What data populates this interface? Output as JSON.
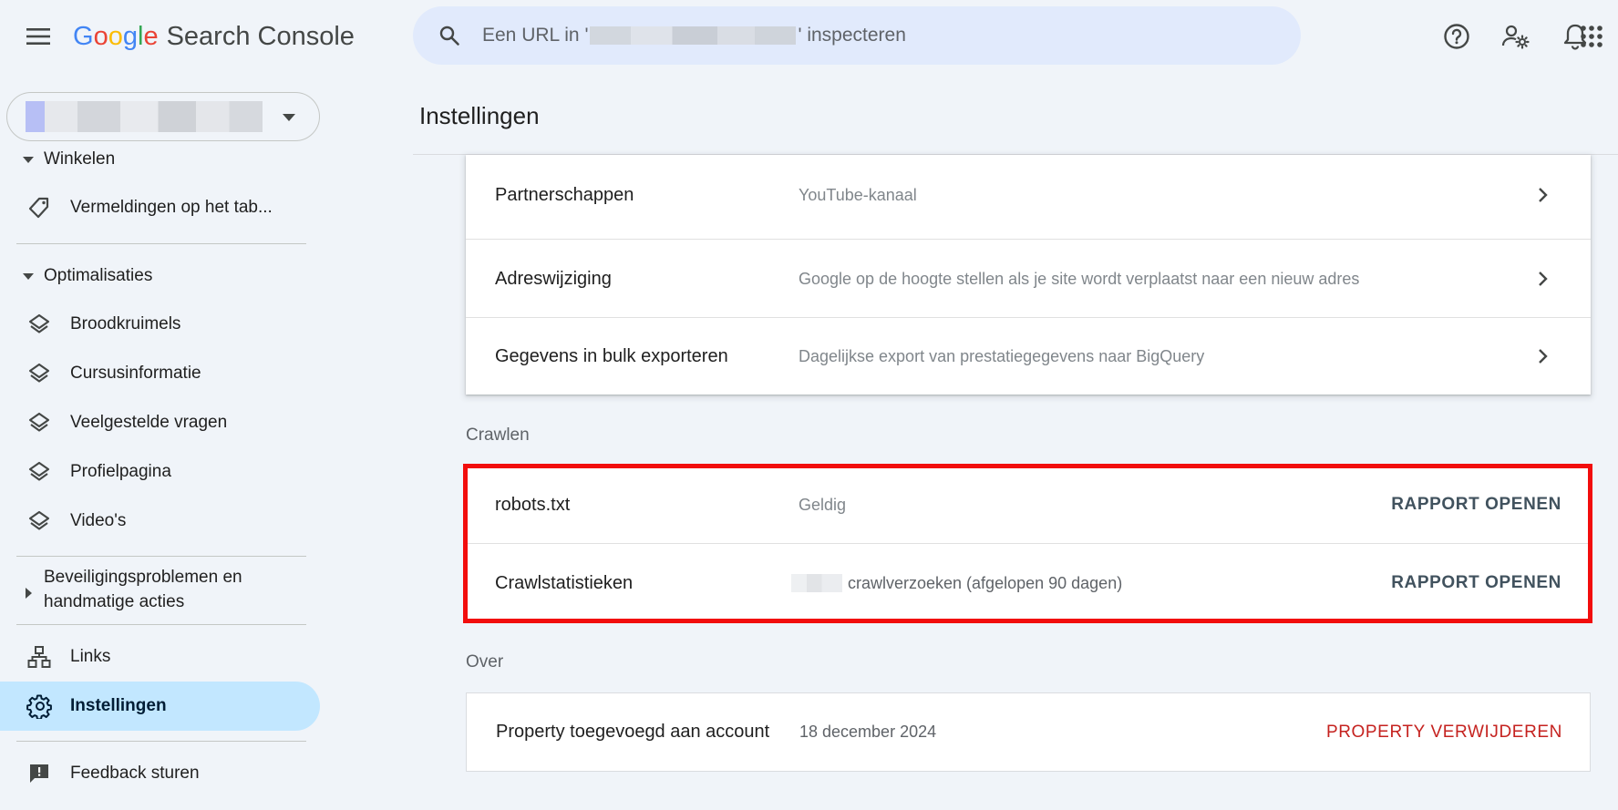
{
  "header": {
    "logo_google": "Google",
    "product_name": "Search Console",
    "search_prefix": "Een URL in '",
    "search_suffix": "' inspecteren",
    "icons": [
      "menu-icon",
      "search-icon",
      "help-icon",
      "manage-users-icon",
      "notifications-icon",
      "apps-grid-icon"
    ]
  },
  "sidebar": {
    "shopping_section": "Winkelen",
    "shopping_items": [
      {
        "label": "Vermeldingen op het tab...",
        "icon": "tag-icon"
      }
    ],
    "enhancements_section": "Optimalisaties",
    "enhancement_items": [
      {
        "label": "Broodkruimels",
        "icon": "layers-icon"
      },
      {
        "label": "Cursusinformatie",
        "icon": "layers-icon"
      },
      {
        "label": "Veelgestelde vragen",
        "icon": "layers-icon"
      },
      {
        "label": "Profielpagina",
        "icon": "layers-icon"
      },
      {
        "label": "Video's",
        "icon": "layers-icon"
      }
    ],
    "security_section_line1": "Beveiligingsproblemen en",
    "security_section_line2": "handmatige acties",
    "links_label": "Links",
    "settings_label": "Instellingen",
    "feedback_label": "Feedback sturen"
  },
  "main": {
    "page_title": "Instellingen",
    "general_rows": [
      {
        "name": "Partnerschappen",
        "desc": "YouTube-kanaal"
      },
      {
        "name": "Adreswijziging",
        "desc": "Google op de hoogte stellen als je site wordt verplaatst naar een nieuw adres"
      },
      {
        "name": "Gegevens in bulk exporteren",
        "desc": "Dagelijkse export van prestatiegegevens naar BigQuery"
      }
    ],
    "crawl_label": "Crawlen",
    "crawl_rows": [
      {
        "name": "robots.txt",
        "desc": "Geldig",
        "action": "RAPPORT OPENEN"
      },
      {
        "name": "Crawlstatistieken",
        "desc": "crawlverzoeken (afgelopen 90 dagen)",
        "action": "RAPPORT OPENEN"
      }
    ],
    "about_label": "Over",
    "about_row": {
      "name": "Property toegevoegd aan account",
      "desc": "18 december 2024",
      "action": "PROPERTY VERWIJDEREN"
    }
  },
  "colors": {
    "background": "#f0f4f9",
    "search_bg": "#e1eafc",
    "active_nav": "#c2e7ff",
    "highlight_border": "#f20d0d",
    "danger": "#c5221f",
    "action": "#41525e"
  }
}
